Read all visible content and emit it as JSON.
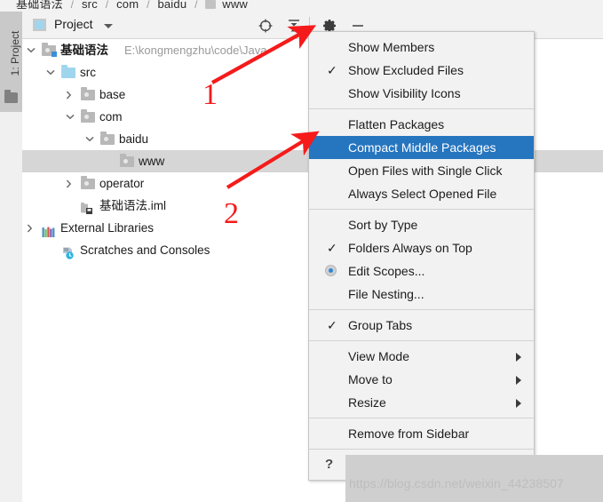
{
  "window": {
    "breadcrumb": [
      "基础语法",
      "src",
      "com",
      "baidu",
      "www"
    ],
    "watermark": "https://blog.csdn.net/weixin_44238507"
  },
  "toolstrip": {
    "tab_label": "1: Project",
    "folder_icon": "folder-icon"
  },
  "panel": {
    "title": "Project",
    "title_icon": "project-view-icon",
    "caret_icon": "chevron-down-icon",
    "toolbar": [
      {
        "name": "select-opened-file-icon",
        "label": "Select Opened File"
      },
      {
        "name": "collapse-all-icon",
        "label": "Collapse All"
      },
      {
        "name": "gear-icon",
        "label": "Options"
      },
      {
        "name": "minimize-icon",
        "label": "Hide"
      }
    ]
  },
  "tree": {
    "rows": [
      {
        "label": "基础语法",
        "path": "E:\\kongmengzhu\\code\\Java",
        "icon": "project-root-folder-icon",
        "twisty": "expanded",
        "indent": 0,
        "bold": true,
        "selected": false
      },
      {
        "label": "src",
        "path": "",
        "icon": "source-folder-icon",
        "twisty": "expanded",
        "indent": 1,
        "bold": false,
        "selected": false
      },
      {
        "label": "base",
        "path": "",
        "icon": "package-folder-icon",
        "twisty": "collapsed",
        "indent": 2,
        "bold": false,
        "selected": false
      },
      {
        "label": "com",
        "path": "",
        "icon": "package-folder-icon",
        "twisty": "expanded",
        "indent": 2,
        "bold": false,
        "selected": false
      },
      {
        "label": "baidu",
        "path": "",
        "icon": "package-folder-icon",
        "twisty": "expanded",
        "indent": 3,
        "bold": false,
        "selected": false
      },
      {
        "label": "www",
        "path": "",
        "icon": "package-folder-icon",
        "twisty": "none",
        "indent": 4,
        "bold": false,
        "selected": true
      },
      {
        "label": "operator",
        "path": "",
        "icon": "package-folder-icon",
        "twisty": "collapsed",
        "indent": 2,
        "bold": false,
        "selected": false
      },
      {
        "label": "基础语法.iml",
        "path": "",
        "icon": "iml-file-icon",
        "twisty": "none",
        "indent": 2,
        "bold": false,
        "selected": false
      },
      {
        "label": "External Libraries",
        "path": "",
        "icon": "libraries-icon",
        "twisty": "collapsed",
        "indent": 0,
        "bold": false,
        "selected": false
      },
      {
        "label": "Scratches and Consoles",
        "path": "",
        "icon": "scratches-icon",
        "twisty": "none",
        "indent": 1,
        "bold": false,
        "selected": false
      }
    ]
  },
  "menu": {
    "highlight_color": "#2675bf",
    "items": [
      {
        "label": "Show Members",
        "state": "none",
        "submenu": false,
        "highlighted": false,
        "separator_after": false
      },
      {
        "label": "Show Excluded Files",
        "state": "checked",
        "submenu": false,
        "highlighted": false,
        "separator_after": false
      },
      {
        "label": "Show Visibility Icons",
        "state": "none",
        "submenu": false,
        "highlighted": false,
        "separator_after": true
      },
      {
        "label": "Flatten Packages",
        "state": "none",
        "submenu": false,
        "highlighted": false,
        "separator_after": false
      },
      {
        "label": "Compact Middle Packages",
        "state": "none",
        "submenu": false,
        "highlighted": true,
        "separator_after": false
      },
      {
        "label": "Open Files with Single Click",
        "state": "none",
        "submenu": false,
        "highlighted": false,
        "separator_after": false
      },
      {
        "label": "Always Select Opened File",
        "state": "none",
        "submenu": false,
        "highlighted": false,
        "separator_after": true
      },
      {
        "label": "Sort by Type",
        "state": "none",
        "submenu": false,
        "highlighted": false,
        "separator_after": false
      },
      {
        "label": "Folders Always on Top",
        "state": "checked",
        "submenu": false,
        "highlighted": false,
        "separator_after": false
      },
      {
        "label": "Edit Scopes...",
        "state": "radio",
        "submenu": false,
        "highlighted": false,
        "separator_after": false
      },
      {
        "label": "File Nesting...",
        "state": "none",
        "submenu": false,
        "highlighted": false,
        "separator_after": true
      },
      {
        "label": "Group Tabs",
        "state": "checked",
        "submenu": false,
        "highlighted": false,
        "separator_after": true
      },
      {
        "label": "View Mode",
        "state": "none",
        "submenu": true,
        "highlighted": false,
        "separator_after": false
      },
      {
        "label": "Move to",
        "state": "none",
        "submenu": true,
        "highlighted": false,
        "separator_after": false
      },
      {
        "label": "Resize",
        "state": "none",
        "submenu": true,
        "highlighted": false,
        "separator_after": true
      },
      {
        "label": "Remove from Sidebar",
        "state": "none",
        "submenu": false,
        "highlighted": false,
        "separator_after": true
      },
      {
        "label": "Help",
        "state": "help",
        "submenu": false,
        "highlighted": false,
        "separator_after": false
      }
    ]
  },
  "annotations": {
    "color": "#f51b1b",
    "markers": [
      {
        "label": "1",
        "target": "gear-icon"
      },
      {
        "label": "2",
        "target": "compact-middle-packages-menu-item"
      }
    ]
  }
}
